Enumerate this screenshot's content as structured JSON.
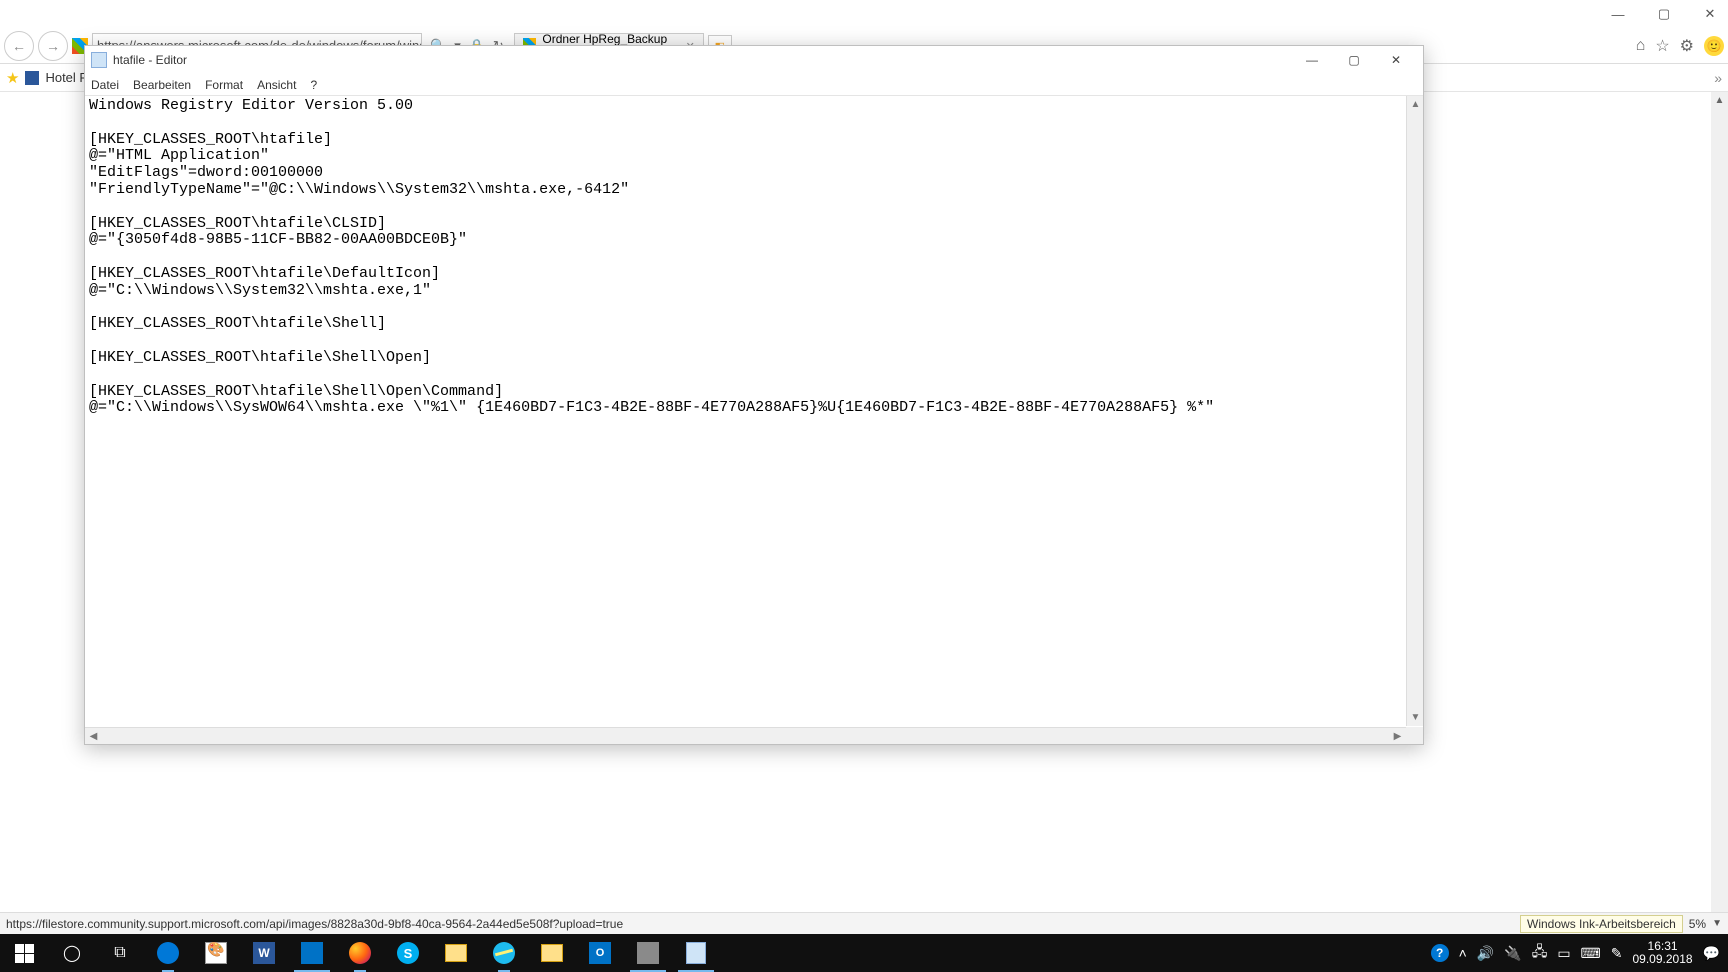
{
  "ie": {
    "url": "https://answers.microsoft.com/de-de/windows/forum/wind",
    "tab1_label": "Ordner HpReg_Backup wur...",
    "home_tooltip": "",
    "fav_label": "Hotel Fo",
    "right_chevron": "»",
    "smiley": "🙂"
  },
  "notepad": {
    "title": "htafile - Editor",
    "menu": {
      "datei": "Datei",
      "bearbeiten": "Bearbeiten",
      "format": "Format",
      "ansicht": "Ansicht",
      "help": "?"
    },
    "content": "Windows Registry Editor Version 5.00\n\n[HKEY_CLASSES_ROOT\\htafile]\n@=\"HTML Application\"\n\"EditFlags\"=dword:00100000\n\"FriendlyTypeName\"=\"@C:\\\\Windows\\\\System32\\\\mshta.exe,-6412\"\n\n[HKEY_CLASSES_ROOT\\htafile\\CLSID]\n@=\"{3050f4d8-98B5-11CF-BB82-00AA00BDCE0B}\"\n\n[HKEY_CLASSES_ROOT\\htafile\\DefaultIcon]\n@=\"C:\\\\Windows\\\\System32\\\\mshta.exe,1\"\n\n[HKEY_CLASSES_ROOT\\htafile\\Shell]\n\n[HKEY_CLASSES_ROOT\\htafile\\Shell\\Open]\n\n[HKEY_CLASSES_ROOT\\htafile\\Shell\\Open\\Command]\n@=\"C:\\\\Windows\\\\SysWOW64\\\\mshta.exe \\\"%1\\\" {1E460BD7-F1C3-4B2E-88BF-4E770A288AF5}%U{1E460BD7-F1C3-4B2E-88BF-4E770A288AF5} %*\""
  },
  "status": {
    "url": "https://filestore.community.support.microsoft.com/api/images/8828a30d-9bf8-40ca-9564-2a44ed5e508f?upload=true",
    "ink_tooltip": "Windows Ink-Arbeitsbereich",
    "zoom_fragment": "5%"
  },
  "taskbar": {
    "time": "16:31",
    "date": "09.09.2018",
    "word_letter": "W",
    "skype_letter": "S",
    "outlook_letter": "O",
    "help_q": "?"
  }
}
